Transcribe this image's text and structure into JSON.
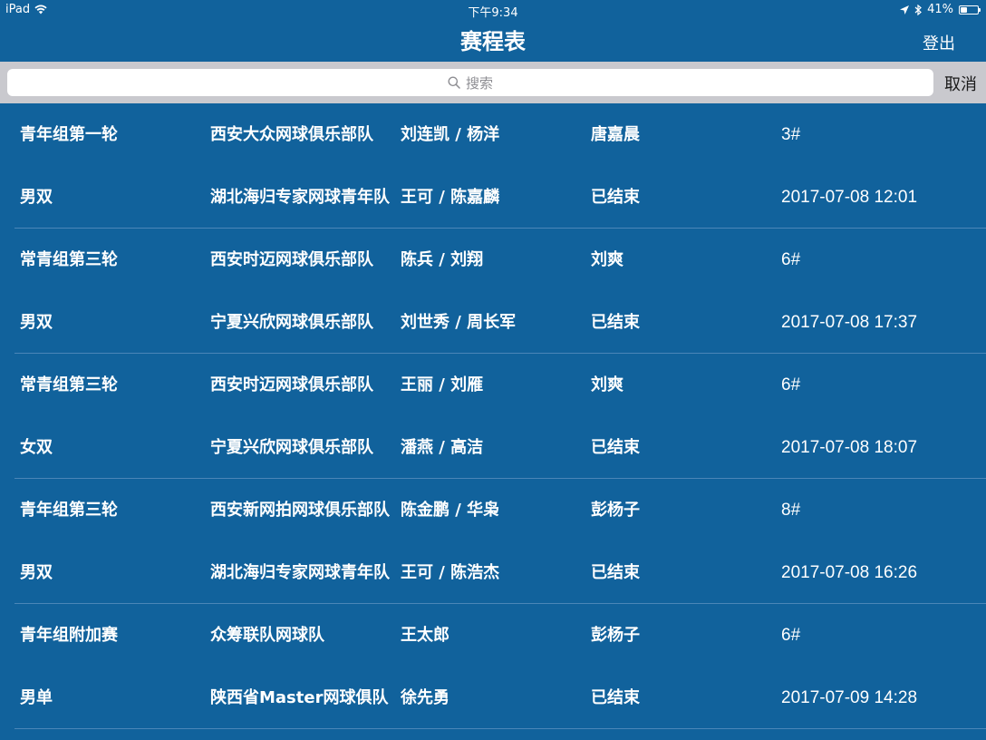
{
  "status_bar": {
    "device": "iPad",
    "time": "下午9:34",
    "battery": "41%",
    "battery_level": 0.41
  },
  "nav": {
    "title": "赛程表",
    "logout": "登出"
  },
  "search": {
    "placeholder": "搜索",
    "cancel": "取消"
  },
  "matches": [
    {
      "top": [
        "青年组第一轮",
        "西安大众网球俱乐部队",
        "刘连凯 / 杨洋",
        "唐嘉晨",
        "3#"
      ],
      "bottom": [
        "男双",
        "湖北海归专家网球青年队",
        "王可 / 陈嘉麟",
        "已结束",
        "2017-07-08 12:01"
      ]
    },
    {
      "top": [
        "常青组第三轮",
        "西安时迈网球俱乐部队",
        "陈兵 / 刘翔",
        "刘爽",
        "6#"
      ],
      "bottom": [
        "男双",
        "宁夏兴欣网球俱乐部队",
        "刘世秀 / 周长军",
        "已结束",
        "2017-07-08 17:37"
      ]
    },
    {
      "top": [
        "常青组第三轮",
        "西安时迈网球俱乐部队",
        "王丽 / 刘雁",
        "刘爽",
        "6#"
      ],
      "bottom": [
        "女双",
        "宁夏兴欣网球俱乐部队",
        "潘燕 / 高洁",
        "已结束",
        "2017-07-08 18:07"
      ]
    },
    {
      "top": [
        "青年组第三轮",
        "西安新网拍网球俱乐部队",
        "陈金鹏 / 华枭",
        "彭杨子",
        "8#"
      ],
      "bottom": [
        "男双",
        "湖北海归专家网球青年队",
        "王可 / 陈浩杰",
        "已结束",
        "2017-07-08 16:26"
      ]
    },
    {
      "top": [
        "青年组附加赛",
        "众筹联队网球队",
        "王太郎",
        "彭杨子",
        "6#"
      ],
      "bottom": [
        "男单",
        "陕西省Master网球俱队",
        "徐先勇",
        "已结束",
        "2017-07-09 14:28"
      ]
    }
  ]
}
